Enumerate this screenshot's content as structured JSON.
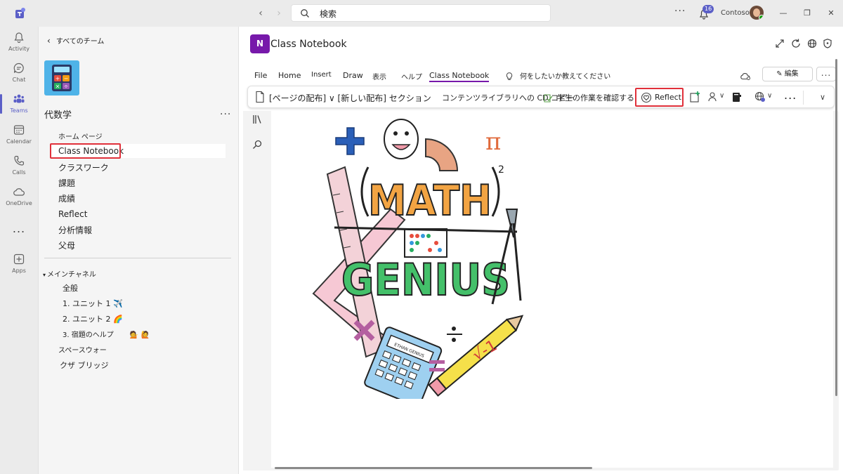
{
  "titlebar": {
    "search_placeholder": "検索",
    "notification_count": "16",
    "org_name": "Contoso",
    "icons": [
      "teams-logo-icon",
      "back-arrow-icon",
      "forward-arrow-icon",
      "search-icon",
      "more-icon",
      "bell-icon",
      "minimize-icon",
      "restore-icon",
      "close-icon"
    ]
  },
  "rail": {
    "items": [
      {
        "label": "Activity",
        "icon": "bell-icon"
      },
      {
        "label": "Chat",
        "icon": "chat-icon"
      },
      {
        "label": "Teams",
        "icon": "teams-icon",
        "active": true
      },
      {
        "label": "Calendar",
        "icon": "calendar-icon"
      },
      {
        "label": "Calls",
        "icon": "phone-icon"
      },
      {
        "label": "OneDrive",
        "icon": "cloud-icon"
      },
      {
        "label": "Apps",
        "icon": "plus-icon"
      }
    ],
    "more": "..."
  },
  "team_panel": {
    "back_label": "すべてのチーム",
    "team_name": "代数学",
    "more": "...",
    "nav": [
      "ホーム ページ",
      "Class Notebook",
      "クラスワーク",
      "課題",
      "成績",
      "Reflect",
      "分析情報",
      "父母"
    ],
    "selected": "Class Notebook",
    "channel_header": "メインチャネル",
    "channels": [
      "全般",
      "1. ユニット 1 ✈️",
      "2. ユニット 2 🌈",
      "3. 宿題のヘルプ",
      "スペースウォー",
      "クザ ブリッジ"
    ],
    "channel_3_emoji": "💁 🙋"
  },
  "notebook": {
    "app_letter": "N",
    "title": "Class Notebook",
    "menu_tabs": [
      "File",
      "Home",
      "Insert",
      "Draw",
      "表示",
      "ヘルプ",
      "Class Notebook"
    ],
    "active_menu": "Class Notebook",
    "tell_me": "何をしたいか教えてください",
    "edit_label": "編集",
    "more": "...",
    "ribbon": {
      "distribute": "[ページの配布] ∨ [新しい配布] セクション",
      "copy_library": "コンテンツライブラリへの CD コピー",
      "review_work": "学生の作業を確認する",
      "reflect": "Reflect",
      "more": "..."
    }
  },
  "artwork": {
    "word1": "MATH",
    "word2": "GENIUS",
    "calculator_text": "ETHAN GENIUS",
    "formula": "√-1",
    "pi": "π",
    "exponent": "2"
  },
  "colors": {
    "accent": "#5b5fc7",
    "onenote": "#7719aa",
    "highlight": "#e0303a"
  }
}
